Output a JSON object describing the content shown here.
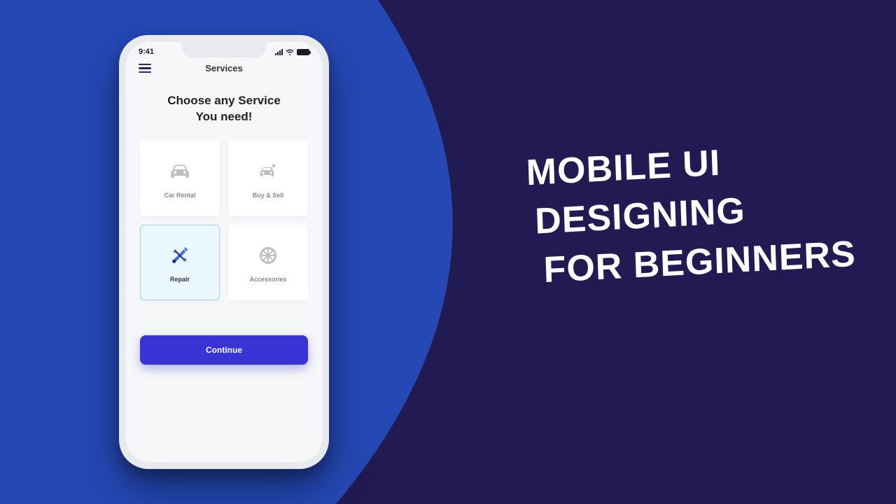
{
  "headline": {
    "line1": "MOBILE UI",
    "line2": "DESIGNING",
    "line3": "FOR BEGINNERS"
  },
  "phone": {
    "status": {
      "time": "9:41"
    },
    "nav": {
      "title": "Services"
    },
    "heading": {
      "line1": "Choose any Service",
      "line2": "You need!"
    },
    "cards": [
      {
        "icon": "car-icon",
        "label": "Car Rental",
        "selected": false
      },
      {
        "icon": "buy-sell-icon",
        "label": "Buy & Sell",
        "selected": false
      },
      {
        "icon": "repair-icon",
        "label": "Repair",
        "selected": true
      },
      {
        "icon": "wheel-icon",
        "label": "Accessories",
        "selected": false
      }
    ],
    "cta": {
      "label": "Continue"
    }
  },
  "colors": {
    "bg_blue": "#2548b5",
    "bg_purple": "#221a53",
    "cta": "#3a33d6",
    "selected_bg": "#ecf8ff",
    "selected_border": "#9cd7e8"
  }
}
